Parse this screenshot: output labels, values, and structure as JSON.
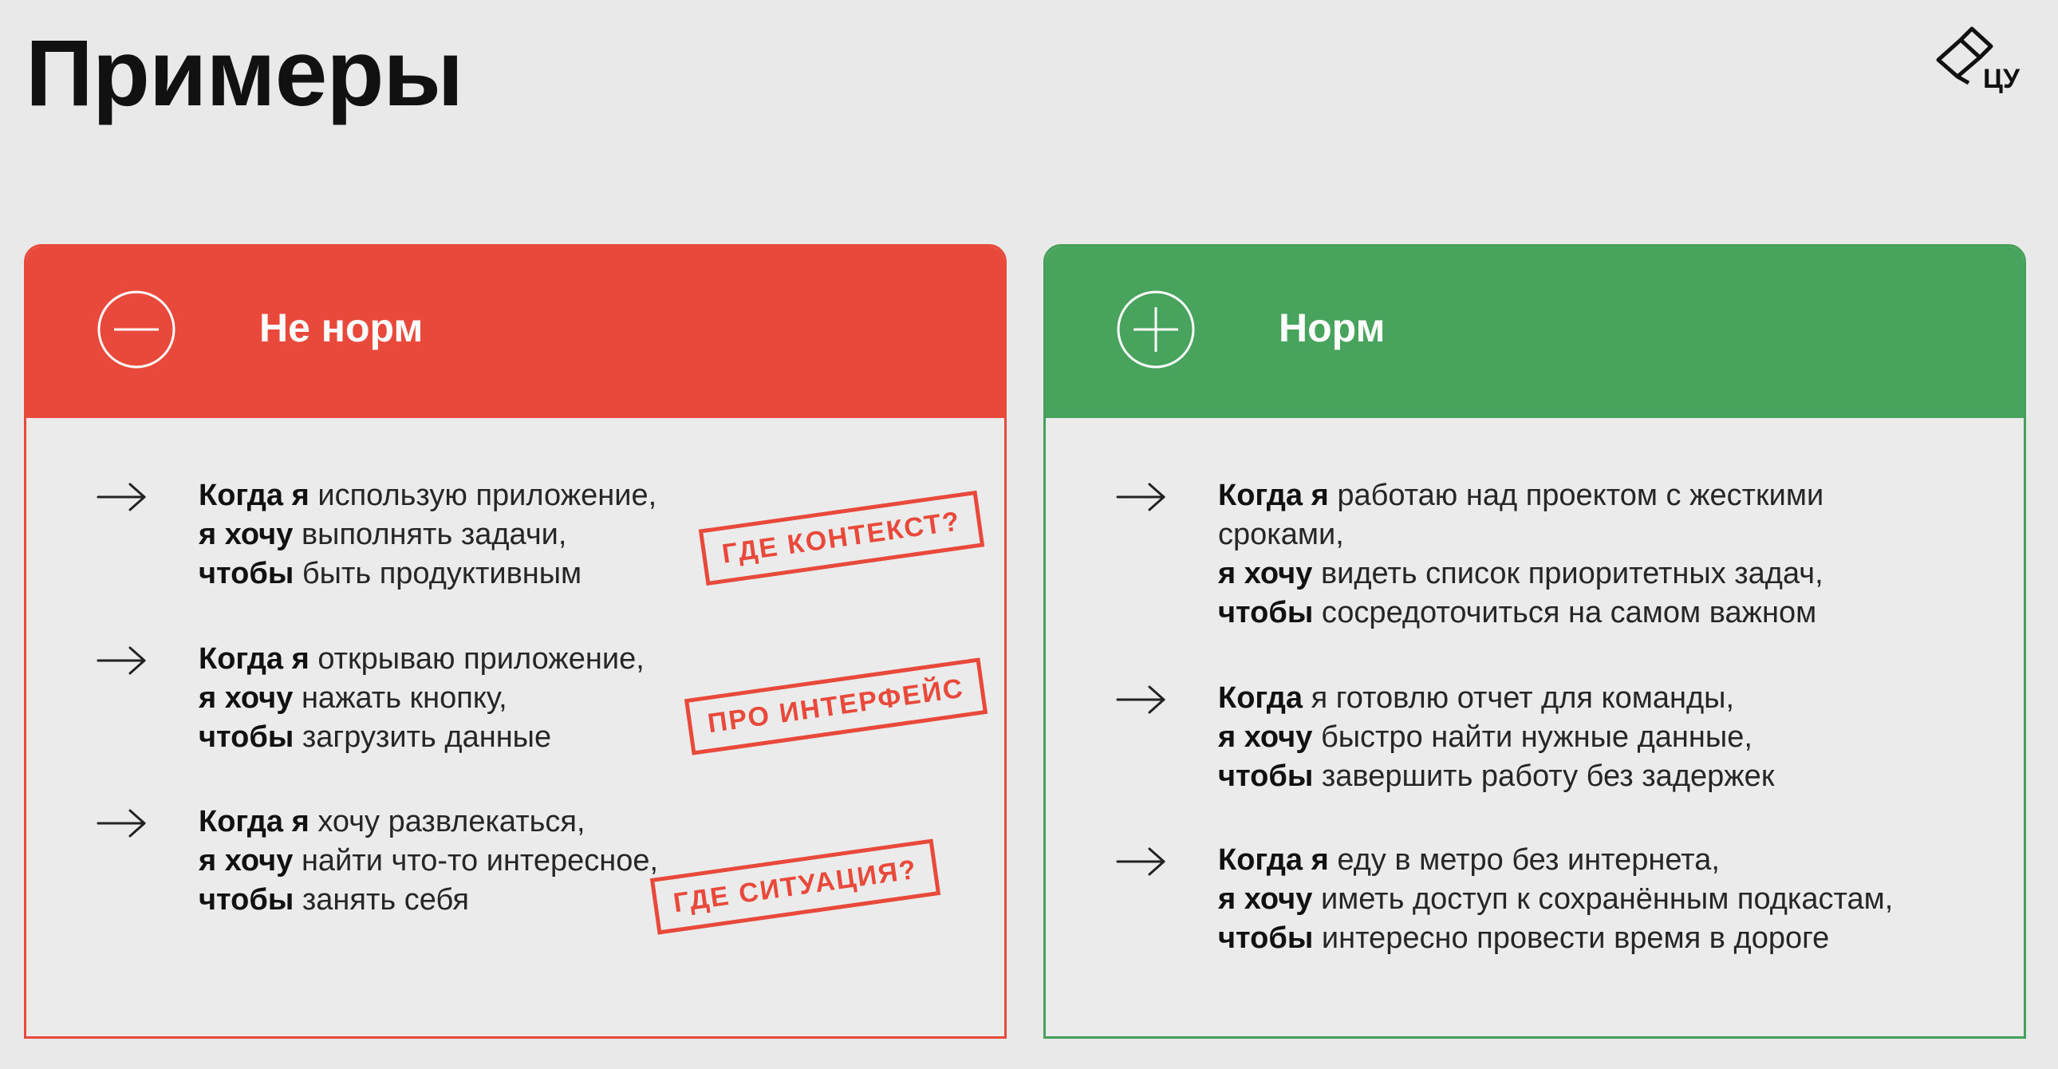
{
  "page": {
    "title": "Примеры",
    "logo_text": "ЦУ"
  },
  "colors": {
    "bad": "#e8493a",
    "good": "#48a35c",
    "background": "#e9e9e9"
  },
  "bad_panel": {
    "title": "Не норм",
    "icon": "minus-circle-icon",
    "items": [
      {
        "lines": [
          {
            "bold": "Когда я",
            "text": " использую приложение,"
          },
          {
            "bold": "я хочу",
            "text": " выполнять задачи,"
          },
          {
            "bold": "чтобы",
            "text": " быть продуктивным"
          }
        ],
        "stamp": "ГДЕ КОНТЕКСТ?"
      },
      {
        "lines": [
          {
            "bold": "Когда я",
            "text": " открываю приложение,"
          },
          {
            "bold": "я хочу",
            "text": " нажать кнопку,"
          },
          {
            "bold": "чтобы",
            "text": " загрузить данные"
          }
        ],
        "stamp": "ПРО ИНТЕРФЕЙС"
      },
      {
        "lines": [
          {
            "bold": "Когда я",
            "text": " хочу развлекаться,"
          },
          {
            "bold": "я хочу",
            "text": " найти что-то интересное,"
          },
          {
            "bold": "чтобы",
            "text": " занять себя"
          }
        ],
        "stamp": "ГДЕ СИТУАЦИЯ?"
      }
    ]
  },
  "good_panel": {
    "title": "Норм",
    "icon": "plus-circle-icon",
    "items": [
      {
        "lines": [
          {
            "bold": "Когда я",
            "text": " работаю над проектом с жесткими"
          },
          {
            "bold": "",
            "text": "сроками,"
          },
          {
            "bold": "я хочу",
            "text": " видеть список приоритетных задач,"
          },
          {
            "bold": "чтобы",
            "text": " сосредоточиться на самом важном"
          }
        ]
      },
      {
        "lines": [
          {
            "bold": "Когда",
            "text": " я готовлю отчет для команды,"
          },
          {
            "bold": "я хочу",
            "text": " быстро найти нужные данные,"
          },
          {
            "bold": "чтобы",
            "text": " завершить работу без задержек"
          }
        ]
      },
      {
        "lines": [
          {
            "bold": "Когда я",
            "text": " еду в метро без интернета,"
          },
          {
            "bold": "я хочу",
            "text": " иметь доступ к сохранённым подкастам,"
          },
          {
            "bold": "чтобы",
            "text": " интересно провести время в дороге"
          }
        ]
      }
    ]
  }
}
